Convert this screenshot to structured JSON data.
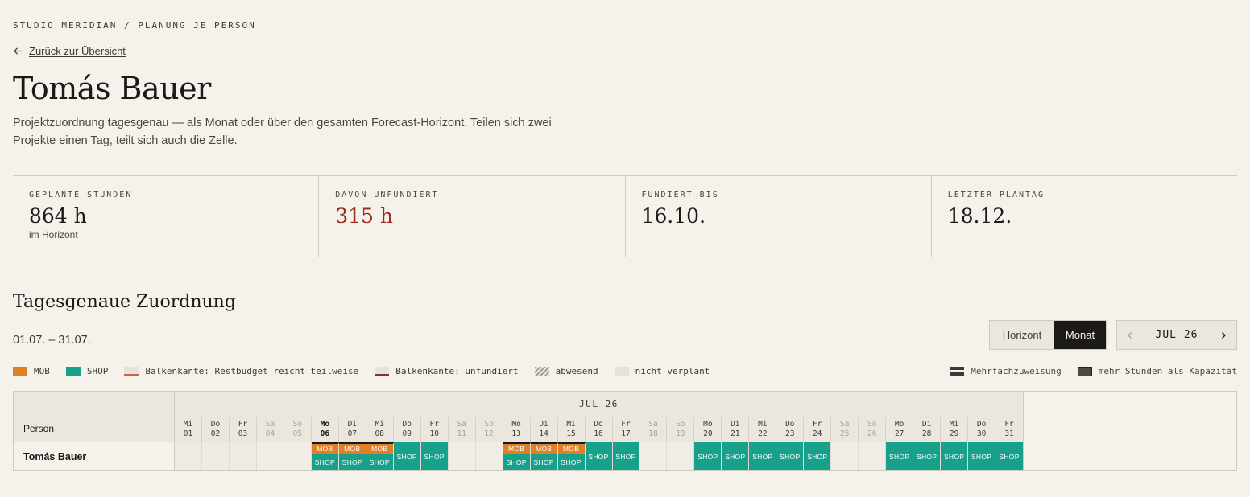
{
  "breadcrumb": "STUDIO MERIDIAN / PLANUNG JE PERSON",
  "back_link": "Zurück zur Übersicht",
  "title": "Tomás Bauer",
  "description": "Projektzuordnung tagesgenau — als Monat oder über den gesamten Forecast-Horizont. Teilen sich zwei Projekte einen Tag, teilt sich auch die Zelle.",
  "kpis": [
    {
      "label": "GEPLANTE STUNDEN",
      "value": "864 h",
      "sub": "im Horizont"
    },
    {
      "label": "DAVON UNFUNDIERT",
      "value": "315 h",
      "sub": ""
    },
    {
      "label": "FUNDIERT BIS",
      "value": "16.10.",
      "sub": ""
    },
    {
      "label": "LETZTER PLANTAG",
      "value": "18.12.",
      "sub": ""
    }
  ],
  "section": {
    "title": "Tagesgenaue Zuordnung",
    "range": "01.07. – 31.07."
  },
  "view_toggle": {
    "horizon": "Horizont",
    "month": "Monat",
    "active": "month"
  },
  "pager": {
    "label": "JUL 26"
  },
  "legend": {
    "left": [
      {
        "key": "mob",
        "label": "MOB"
      },
      {
        "key": "shop",
        "label": "SHOP"
      },
      {
        "key": "partial",
        "label": "Balkenkante: Restbudget reicht teilweise"
      },
      {
        "key": "unfunded",
        "label": "Balkenkante: unfundiert"
      },
      {
        "key": "absent",
        "label": "abwesend"
      },
      {
        "key": "free",
        "label": "nicht verplant"
      }
    ],
    "right": [
      {
        "key": "multi",
        "label": "Mehrfachzuweisung"
      },
      {
        "key": "over",
        "label": "mehr Stunden als Kapazität"
      }
    ]
  },
  "colors": {
    "mob": "#e07f28",
    "shop": "#17a08a",
    "unfunded": "#9b2a22",
    "partial": "#c4693a",
    "accent_dark": "#1c1a17"
  },
  "grid": {
    "person_header": "Person",
    "month_label": "JUL 26",
    "person": "Tomás Bauer",
    "days": [
      {
        "wd": "Mi",
        "d": "01",
        "we": false,
        "a": []
      },
      {
        "wd": "Do",
        "d": "02",
        "we": false,
        "a": []
      },
      {
        "wd": "Fr",
        "d": "03",
        "we": false,
        "a": []
      },
      {
        "wd": "Sa",
        "d": "04",
        "we": true,
        "a": []
      },
      {
        "wd": "So",
        "d": "05",
        "we": true,
        "a": []
      },
      {
        "wd": "Mo",
        "d": "06",
        "we": false,
        "today": true,
        "a": [
          "MOB",
          "SHOP"
        ]
      },
      {
        "wd": "Di",
        "d": "07",
        "we": false,
        "a": [
          "MOB",
          "SHOP"
        ]
      },
      {
        "wd": "Mi",
        "d": "08",
        "we": false,
        "a": [
          "MOB",
          "SHOP"
        ]
      },
      {
        "wd": "Do",
        "d": "09",
        "we": false,
        "a": [
          "SHOP"
        ]
      },
      {
        "wd": "Fr",
        "d": "10",
        "we": false,
        "a": [
          "SHOP"
        ]
      },
      {
        "wd": "Sa",
        "d": "11",
        "we": true,
        "a": []
      },
      {
        "wd": "So",
        "d": "12",
        "we": true,
        "a": []
      },
      {
        "wd": "Mo",
        "d": "13",
        "we": false,
        "a": [
          "MOB",
          "SHOP"
        ]
      },
      {
        "wd": "Di",
        "d": "14",
        "we": false,
        "a": [
          "MOB",
          "SHOP"
        ]
      },
      {
        "wd": "Mi",
        "d": "15",
        "we": false,
        "a": [
          "MOB",
          "SHOP"
        ]
      },
      {
        "wd": "Do",
        "d": "16",
        "we": false,
        "a": [
          "SHOP"
        ]
      },
      {
        "wd": "Fr",
        "d": "17",
        "we": false,
        "a": [
          "SHOP"
        ]
      },
      {
        "wd": "Sa",
        "d": "18",
        "we": true,
        "a": []
      },
      {
        "wd": "So",
        "d": "19",
        "we": true,
        "a": []
      },
      {
        "wd": "Mo",
        "d": "20",
        "we": false,
        "a": [
          "SHOP"
        ]
      },
      {
        "wd": "Di",
        "d": "21",
        "we": false,
        "a": [
          "SHOP"
        ]
      },
      {
        "wd": "Mi",
        "d": "22",
        "we": false,
        "a": [
          "SHOP"
        ]
      },
      {
        "wd": "Do",
        "d": "23",
        "we": false,
        "a": [
          "SHOP"
        ]
      },
      {
        "wd": "Fr",
        "d": "24",
        "we": false,
        "a": [
          "SHOP"
        ]
      },
      {
        "wd": "Sa",
        "d": "25",
        "we": true,
        "a": []
      },
      {
        "wd": "So",
        "d": "26",
        "we": true,
        "a": []
      },
      {
        "wd": "Mo",
        "d": "27",
        "we": false,
        "a": [
          "SHOP"
        ]
      },
      {
        "wd": "Di",
        "d": "28",
        "we": false,
        "a": [
          "SHOP"
        ]
      },
      {
        "wd": "Mi",
        "d": "29",
        "we": false,
        "a": [
          "SHOP"
        ]
      },
      {
        "wd": "Do",
        "d": "30",
        "we": false,
        "a": [
          "SHOP"
        ]
      },
      {
        "wd": "Fr",
        "d": "31",
        "we": false,
        "a": [
          "SHOP"
        ]
      }
    ]
  }
}
